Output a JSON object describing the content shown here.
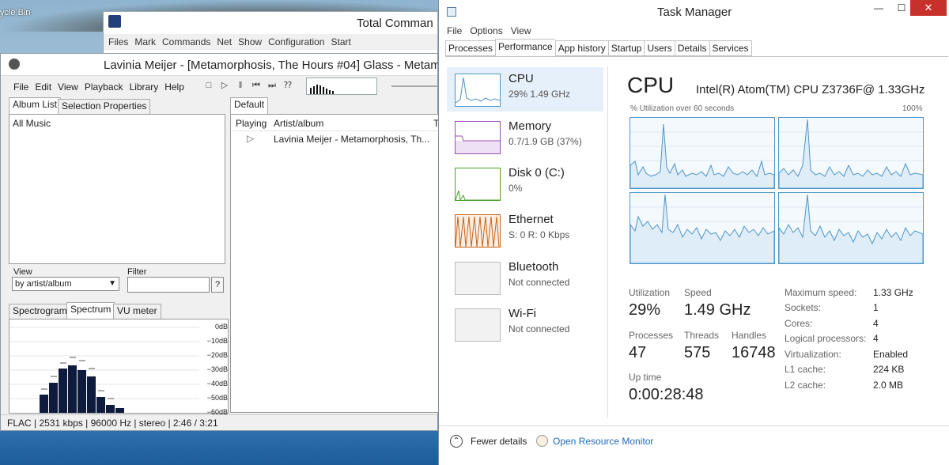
{
  "desktop": {
    "recycle_label": "ycle Bin"
  },
  "total_commander": {
    "title": "Total Comman",
    "menu": [
      "Files",
      "Mark",
      "Commands",
      "Net",
      "Show",
      "Configuration",
      "Start"
    ]
  },
  "foobar": {
    "title": "Lavinia Meijer - [Metamorphosis, The Hours #04] Glass - Metam",
    "menu": [
      "File",
      "Edit",
      "View",
      "Playback",
      "Library",
      "Help"
    ],
    "left_tabs": [
      "Album List",
      "Selection Properties"
    ],
    "tree_root": "All Music",
    "view_label": "View",
    "view_value": "by artist/album",
    "filter_label": "Filter",
    "filter_button": "?",
    "viz_tabs": [
      "Spectrogram",
      "Spectrum",
      "VU meter"
    ],
    "db_labels": [
      "0dB",
      "−10dB",
      "−20dB",
      "−30dB",
      "−40dB",
      "−50dB",
      "−60dB"
    ],
    "playlist_tab": "Default",
    "columns": [
      "Playing",
      "Artist/album",
      "T"
    ],
    "rows": [
      {
        "playing": "▷",
        "artist_album": "Lavinia Meijer - Metamorphosis, Th..."
      }
    ],
    "status": "FLAC | 2531 kbps | 96000 Hz | stereo | 2:46 / 3:21"
  },
  "task_manager": {
    "title": "Task Manager",
    "menu": [
      "File",
      "Options",
      "View"
    ],
    "tabs": [
      "Processes",
      "Performance",
      "App history",
      "Startup",
      "Users",
      "Details",
      "Services"
    ],
    "active_tab": "Performance",
    "resources": [
      {
        "name": "CPU",
        "sub": "29%  1.49 GHz"
      },
      {
        "name": "Memory",
        "sub": "0.7/1.9 GB (37%)"
      },
      {
        "name": "Disk 0 (C:)",
        "sub": "0%"
      },
      {
        "name": "Ethernet",
        "sub": "S: 0  R: 0 Kbps"
      },
      {
        "name": "Bluetooth",
        "sub": "Not connected"
      },
      {
        "name": "Wi-Fi",
        "sub": "Not connected"
      }
    ],
    "cpu": {
      "heading": "CPU",
      "model": "Intel(R) Atom(TM) CPU Z3736F@ 1.33GHz",
      "util_label": "% Utilization over 60 seconds",
      "util_max": "100%",
      "utilization_label": "Utilization",
      "utilization": "29%",
      "speed_label": "Speed",
      "speed": "1.49 GHz",
      "processes_label": "Processes",
      "processes": "47",
      "threads_label": "Threads",
      "threads": "575",
      "handles_label": "Handles",
      "handles": "16748",
      "uptime_label": "Up time",
      "uptime": "0:00:28:48",
      "specs": [
        {
          "k": "Maximum speed:",
          "v": "1.33 GHz"
        },
        {
          "k": "Sockets:",
          "v": "1"
        },
        {
          "k": "Cores:",
          "v": "4"
        },
        {
          "k": "Logical processors:",
          "v": "4"
        },
        {
          "k": "Virtualization:",
          "v": "Enabled"
        },
        {
          "k": "L1 cache:",
          "v": "224 KB"
        },
        {
          "k": "L2 cache:",
          "v": "2.0 MB"
        }
      ]
    },
    "footer": {
      "fewer": "Fewer details",
      "resource_monitor": "Open Resource Monitor"
    },
    "colors": {
      "cpu": "#4f95c9",
      "memory": "#9b4db6",
      "disk": "#4aa02c",
      "ethernet": "#c4651d"
    }
  }
}
